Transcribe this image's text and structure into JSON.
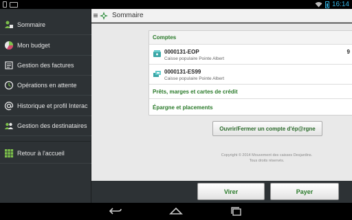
{
  "status_bar": {
    "time": "16:14",
    "icons": [
      "phone-icon",
      "keyboard-icon",
      "wifi-icon",
      "battery-icon"
    ],
    "accent_color": "#33b5e5"
  },
  "sidebar": {
    "items": [
      {
        "label": "Sommaire",
        "icon": "accounts-icon"
      },
      {
        "label": "Mon budget",
        "icon": "pie-chart-icon"
      },
      {
        "label": "Gestion des factures",
        "icon": "invoice-icon"
      },
      {
        "label": "Opérations en attente",
        "icon": "clock-icon"
      },
      {
        "label": "Historique et profil Interac",
        "icon": "at-icon"
      },
      {
        "label": "Gestion des destinataires",
        "icon": "people-icon"
      },
      {
        "label": "Retour à l'accueil",
        "icon": "grid-icon"
      }
    ]
  },
  "action_bar": {
    "title": "Sommaire",
    "brand_color": "#2a8a3a"
  },
  "main": {
    "sections": {
      "comptes": "Comptes",
      "prets": "Prêts, marges et cartes de crédit",
      "epargne": "Épargne et placements"
    },
    "accounts": [
      {
        "number": "0000131-EOP",
        "institution": "Caisse populaire Pointe Albert",
        "amount": "9",
        "icon": "bank-account-icon"
      },
      {
        "number": "0000131-ES99",
        "institution": "Caisse populaire Pointe Albert",
        "amount": "",
        "icon": "savings-account-icon"
      }
    ],
    "savings_button": "Ouvrir/Fermer un compte d'ép@rgne",
    "copyright_line1": "Copyright © 2014 Mouvement des caisses Desjardins.",
    "copyright_line2": "Tous droits réservés."
  },
  "bottom_bar": {
    "transfer_label": "Virer",
    "pay_label": "Payer"
  },
  "nav_bar": {
    "icons": [
      "back-icon",
      "home-icon",
      "recent-apps-icon"
    ]
  }
}
